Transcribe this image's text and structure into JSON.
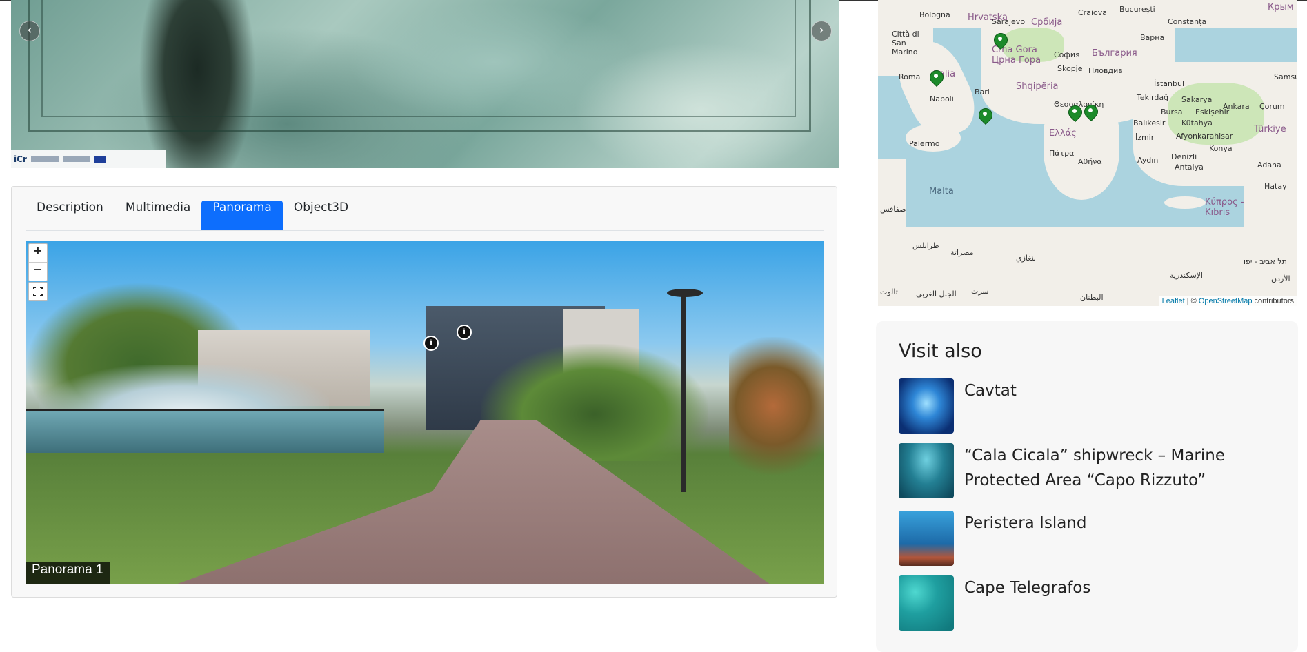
{
  "carousel": {
    "logo_text": "iCr",
    "prev_icon": "chevron-left-icon",
    "next_icon": "chevron-right-icon",
    "prev_glyph": "‹",
    "next_glyph": "›"
  },
  "tabs": [
    {
      "label": "Description",
      "active": false
    },
    {
      "label": "Multimedia",
      "active": false
    },
    {
      "label": "Panorama",
      "active": true
    },
    {
      "label": "Object3D",
      "active": false
    }
  ],
  "panorama": {
    "zoom_in": "+",
    "zoom_out": "−",
    "label": "Panorama 1",
    "hotspot_glyph": "i"
  },
  "map": {
    "labels": {
      "bologna": "Bologna",
      "hrvatska": "Hrvatska",
      "sarajevo": "Sarajevo",
      "srbija": "Србија",
      "craiova": "Craiova",
      "bucuresti": "București",
      "constanta": "Constanța",
      "krym": "Крым",
      "san_marino": "Città di San Marino",
      "crna_gora": "Crna Gora",
      "crna_gora_cyr": "Црна Гора",
      "sofia": "София",
      "bulgaria": "България",
      "varna": "Варна",
      "roma": "Roma",
      "italia": "Italia",
      "skopje": "Skopje",
      "plovdiv": "Пловдив",
      "istanbul": "İstanbul",
      "samsun": "Samsu",
      "napoli": "Napoli",
      "bari": "Bari",
      "shqiperia": "Shqipëria",
      "thessaloniki": "Θεσσαλονίκη",
      "tekirdag": "Tekirdağ",
      "sakarya": "Sakarya",
      "ankara": "Ankara",
      "corum": "Çorum",
      "bursa": "Bursa",
      "eskisehir": "Eskişehir",
      "turkiye": "Türkiye",
      "balikesir": "Balıkesir",
      "kutahya": "Kütahya",
      "palermo": "Palermo",
      "ellada": "Ελλάς",
      "izmir": "İzmir",
      "afyon": "Afyonkarahisar",
      "patra": "Πάτρα",
      "athina": "Αθήνα",
      "aydin": "Aydın",
      "denizli": "Denizli",
      "konya": "Konya",
      "antalya": "Antalya",
      "adana": "Adana",
      "malta": "Malta",
      "kypros": "Κύπρος - Kıbrıs",
      "hatay": "Hatay",
      "tarabulus": "طرابلس",
      "misrata": "مصراتة",
      "benghazi": "بنغازي",
      "tel_aviv": "תל אביב - יפו",
      "iskandariya": "الإسكندرية",
      "urdun": "الأردن",
      "jabal": "الجبل الغربي",
      "sirte": "سرت",
      "batnan": "البطنان",
      "safaqis": "صفاقس",
      "tunis": "تالوت"
    },
    "attribution": {
      "leaflet": "Leaflet",
      "sep": " | © ",
      "osm": "OpenStreetMap",
      "contrib": " contributors"
    }
  },
  "visit_also": {
    "heading": "Visit also",
    "items": [
      {
        "title": "Cavtat",
        "thumb_color": "#1b4fa0"
      },
      {
        "title": "“Cala Cicala” shipwreck – Marine Protected Area “Capo Rizzuto”",
        "thumb_color": "#1d7a8c"
      },
      {
        "title": "Peristera Island",
        "thumb_color": "#1e6fa6"
      },
      {
        "title": "Cape Telegrafos",
        "thumb_color": "#1fa8a8"
      }
    ]
  }
}
